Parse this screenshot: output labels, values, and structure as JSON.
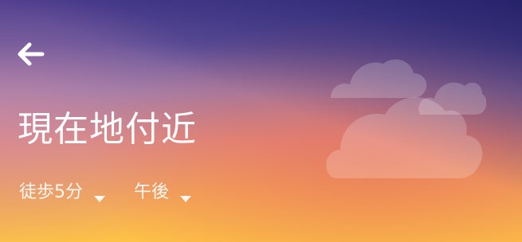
{
  "header": {
    "back_icon": "back-arrow-icon",
    "title": "現在地付近"
  },
  "filters": {
    "walk_time": {
      "label": "徒歩5分",
      "icon": "caret-down-icon"
    },
    "time_of_day": {
      "label": "午後",
      "icon": "caret-down-icon"
    }
  },
  "weather": {
    "icon": "cloudy-icon"
  },
  "colors": {
    "sky_top": "#2c2a78",
    "sky_mid": "#e0897c",
    "sky_bottom": "#fdc246",
    "text": "#ffffff"
  }
}
